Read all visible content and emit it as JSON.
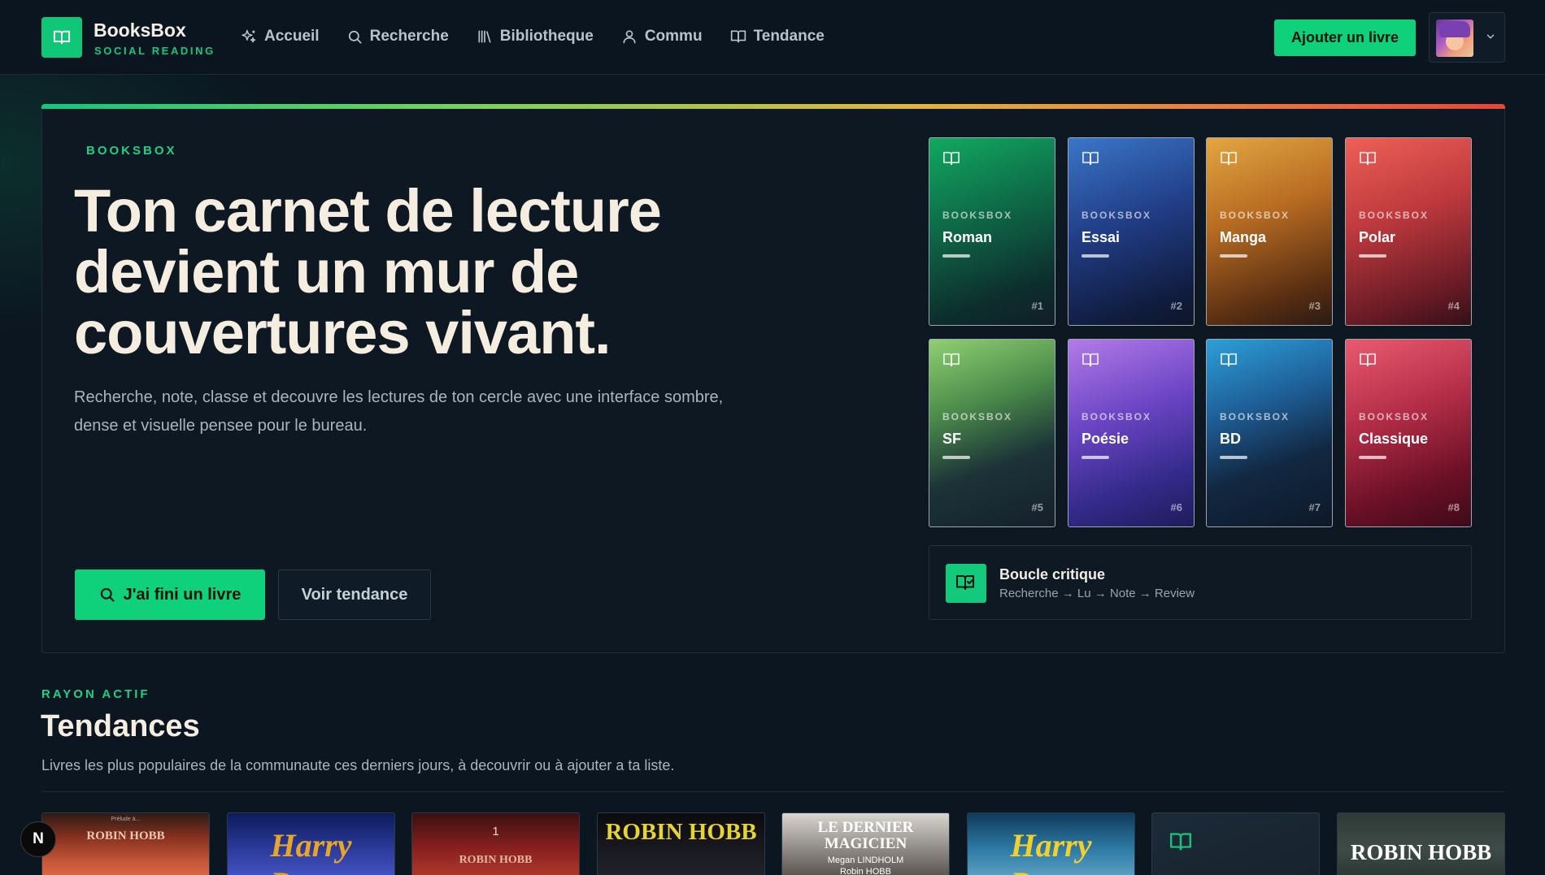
{
  "brand": {
    "name": "BooksBox",
    "tagline": "SOCIAL READING"
  },
  "nav": [
    {
      "label": "Accueil",
      "icon": "sparkles-icon"
    },
    {
      "label": "Recherche",
      "icon": "search-icon"
    },
    {
      "label": "Bibliotheque",
      "icon": "library-icon"
    },
    {
      "label": "Commu",
      "icon": "user-icon"
    },
    {
      "label": "Tendance",
      "icon": "book-open-icon"
    }
  ],
  "header": {
    "add_label": "Ajouter un livre"
  },
  "hero": {
    "eyebrow": "BOOKSBOX",
    "headline": "Ton carnet de lecture devient un mur de couvertures vivant.",
    "lede": "Recherche, note, classe et decouvre les lectures de ton cercle avec une interface sombre, dense et visuelle pensee pour le bureau.",
    "cta_primary": "J'ai fini un livre",
    "cta_secondary": "Voir tendance"
  },
  "genres": [
    {
      "kicker": "BOOKSBOX",
      "title": "Roman",
      "num": "#1"
    },
    {
      "kicker": "BOOKSBOX",
      "title": "Essai",
      "num": "#2"
    },
    {
      "kicker": "BOOKSBOX",
      "title": "Manga",
      "num": "#3"
    },
    {
      "kicker": "BOOKSBOX",
      "title": "Polar",
      "num": "#4"
    },
    {
      "kicker": "BOOKSBOX",
      "title": "SF",
      "num": "#5"
    },
    {
      "kicker": "BOOKSBOX",
      "title": "Poésie",
      "num": "#6"
    },
    {
      "kicker": "BOOKSBOX",
      "title": "BD",
      "num": "#7"
    },
    {
      "kicker": "BOOKSBOX",
      "title": "Classique",
      "num": "#8"
    }
  ],
  "loop": {
    "title": "Boucle critique",
    "subtitle": "Recherche → Lu → Note → Review"
  },
  "section": {
    "eyebrow": "RAYON ACTIF",
    "title": "Tendances",
    "description": "Livres les plus populaires de la communaute ces derniers jours, à decouvrir ou à ajouter a ta liste."
  },
  "books": [
    {
      "author": "ROBIN HOBB",
      "title": "",
      "extra": "Prélude à..."
    },
    {
      "author": "",
      "title": "Harry Potter",
      "extra": ""
    },
    {
      "author": "ROBIN HOBB",
      "title": "",
      "extra": "1"
    },
    {
      "author": "ROBIN HOBB",
      "title": "",
      "extra": ""
    },
    {
      "author": "Megan LINDHOLM",
      "title": "LE DERNIER MAGICIEN",
      "extra": "Robin HOBB"
    },
    {
      "author": "",
      "title": "Harry Potter",
      "extra": ""
    },
    {
      "author": "",
      "title": "",
      "extra": ""
    },
    {
      "author": "ROBIN HOBB",
      "title": "",
      "extra": ""
    }
  ],
  "colors": {
    "accent": "#0fd17b",
    "background": "#0b1621"
  },
  "badge": {
    "letter": "N"
  }
}
